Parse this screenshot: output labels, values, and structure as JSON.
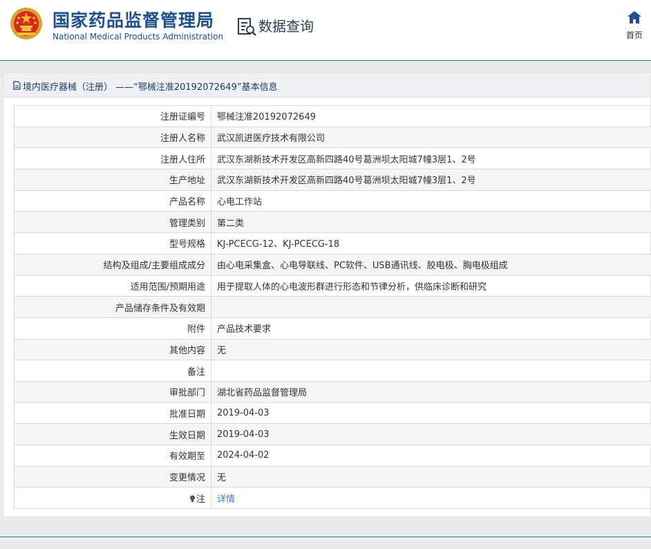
{
  "header": {
    "title_cn": "国家药品监督管理局",
    "title_en": "National Medical Products Administration",
    "query_label": "数据查询",
    "home_label": "首页"
  },
  "panel": {
    "title": "境内医疗器械（注册） ——“鄂械注准20192072649”基本信息"
  },
  "rows": [
    {
      "label": "注册证编号",
      "value": "鄂械注准20192072649"
    },
    {
      "label": "注册人名称",
      "value": "武汉凯进医疗技术有限公司"
    },
    {
      "label": "注册人住所",
      "value": "武汉东湖新技术开发区高新四路40号葛洲坝太阳城7幢3层1、2号"
    },
    {
      "label": "生产地址",
      "value": "武汉东湖新技术开发区高新四路40号葛洲坝太阳城7幢3层1、2号"
    },
    {
      "label": "产品名称",
      "value": "心电工作站"
    },
    {
      "label": "管理类别",
      "value": "第二类"
    },
    {
      "label": "型号规格",
      "value": "KJ-PCECG-12、KJ-PCECG-18"
    },
    {
      "label": "结构及组成/主要组成成分",
      "value": "由心电采集盒、心电导联线、PC软件、USB通讯线、胶电极、胸电极组成"
    },
    {
      "label": "适用范围/预期用途",
      "value": "用于提取人体的心电波形群进行形态和节律分析，供临床诊断和研究"
    },
    {
      "label": "产品储存条件及有效期",
      "value": ""
    },
    {
      "label": "附件",
      "value": "产品技术要求"
    },
    {
      "label": "其他内容",
      "value": "无"
    },
    {
      "label": "备注",
      "value": ""
    },
    {
      "label": "审批部门",
      "value": "湖北省药品监督管理局"
    },
    {
      "label": "批准日期",
      "value": "2019-04-03"
    },
    {
      "label": "生效日期",
      "value": "2019-04-03"
    },
    {
      "label": "有效期至",
      "value": "2024-04-02"
    },
    {
      "label": "变更情况",
      "value": "无"
    }
  ],
  "note_row": {
    "label": "注",
    "link": "详情"
  },
  "colors": {
    "brand_blue": "#1e4f8f",
    "link": "#3a7fc1",
    "rule": "#2f7a96"
  },
  "icons": {
    "emblem": "national-emblem-icon",
    "query": "data-query-icon",
    "home": "home-icon",
    "doc": "document-icon",
    "bulb": "lightbulb-icon"
  }
}
